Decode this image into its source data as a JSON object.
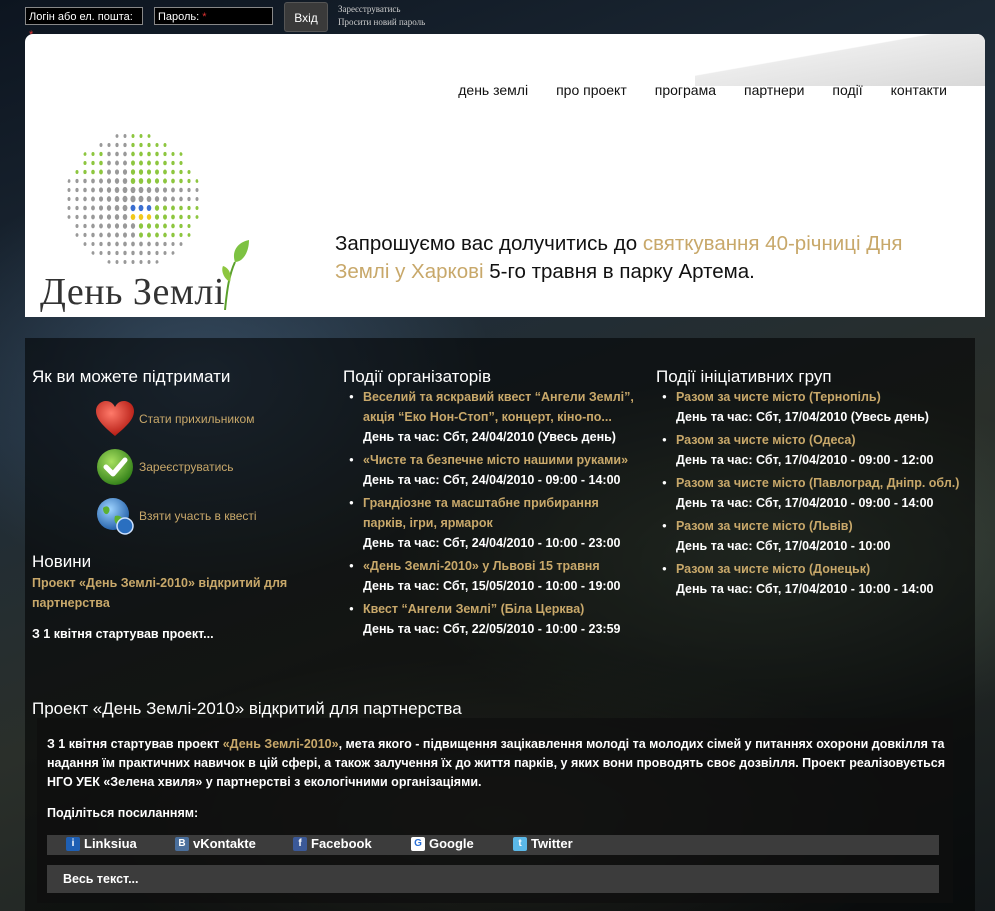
{
  "login": {
    "login_placeholder": "Логін або ел. пошта:",
    "password_placeholder": "Пароль:",
    "required_mark": "*",
    "submit_label": "Вхід",
    "register_link": "Зареєструватись",
    "forgot_link": "Просити новий пароль"
  },
  "nav": [
    "день землі",
    "про проект",
    "програма",
    "партнери",
    "події",
    "контакти"
  ],
  "logo": {
    "text": "День Землі"
  },
  "intro": {
    "part1": "Запрошуємо вас долучитись до ",
    "highlight": "святкування 40-річниці Дня Землі у Харкові",
    "part2": " 5-го травня в парку Артема."
  },
  "support": {
    "title": "Як ви можете підтримати",
    "items": [
      {
        "label": "Стати прихильником",
        "icon": "heart-icon"
      },
      {
        "label": "Зареєструватись",
        "icon": "checkmark-icon"
      },
      {
        "label": "Взяти участь в квесті",
        "icon": "globe-icon"
      }
    ]
  },
  "news": {
    "title": "Новини",
    "link": "Проект «День Землі-2010» відкритий для партнерства",
    "text": "З 1 квітня стартував проект..."
  },
  "org_events": {
    "title": "Події організаторів",
    "items": [
      {
        "title": "Веселий та яскравий квест “Ангели Землі”, акція “Еко Нон-Стоп”, концерт, кіно-по...",
        "date": "День та час: Сбт, 24/04/2010 (Увесь день)"
      },
      {
        "title": "«Чисте та безпечне місто нашими руками»",
        "date": "День та час: Сбт, 24/04/2010 - 09:00 - 14:00"
      },
      {
        "title": "Грандіозне та масштабне прибирання парків, ігри, ярмарок",
        "date": "День та час: Сбт, 24/04/2010 - 10:00 - 23:00"
      },
      {
        "title": "«День Землі-2010» у Львові 15 травня",
        "date": "День та час: Сбт, 15/05/2010 - 10:00 - 19:00"
      },
      {
        "title": "Квест “Ангели Землі” (Біла Церква)",
        "date": "День та час: Сбт, 22/05/2010 - 10:00 - 23:59"
      }
    ]
  },
  "group_events": {
    "title": "Події ініціативних груп",
    "items": [
      {
        "title": "Разом за чисте місто (Тернопіль)",
        "date": "День та час: Сбт, 17/04/2010 (Увесь день)"
      },
      {
        "title": "Разом за чисте місто (Одеса)",
        "date": "День та час: Сбт, 17/04/2010 - 09:00 - 12:00"
      },
      {
        "title": "Разом за чисте місто (Павлоград, Дніпр. обл.)",
        "date": "День та час: Сбт, 17/04/2010 - 09:00 - 14:00"
      },
      {
        "title": "Разом за чисте місто (Львів)",
        "date": "День та час: Сбт, 17/04/2010 - 10:00"
      },
      {
        "title": "Разом за чисте місто (Донецьк)",
        "date": "День та час: Сбт, 17/04/2010 - 10:00 - 14:00"
      }
    ]
  },
  "article": {
    "title": "Проект «День Землі-2010» відкритий для партнерства",
    "body_start": "З 1 квітня стартував проект ",
    "body_highlight": "«День Землі-2010»",
    "body_rest": ", мета якого - підвищення зацікавлення молоді та молодих сімей у питаннях охорони довкілля та надання їм практичних навичок в цій сфері, а також залучення їх до життя парків, у яких вони проводять своє дозвілля. Проект реалізовується НГО УЕК «Зелена хвиля» у партнерстві з екологічними організаціями.",
    "share_label": "Поділіться посиланням:",
    "share": [
      {
        "label": "Linksiua",
        "icon": "info-icon"
      },
      {
        "label": "vKontakte",
        "icon": "vkontakte-icon"
      },
      {
        "label": "Facebook",
        "icon": "facebook-icon"
      },
      {
        "label": "Google",
        "icon": "google-icon"
      },
      {
        "label": "Twitter",
        "icon": "twitter-icon"
      }
    ],
    "read_more": "Весь текст..."
  },
  "colors": {
    "accent": "#c8a86a",
    "logo_green": "#8dc63f",
    "logo_gray": "#999999"
  }
}
